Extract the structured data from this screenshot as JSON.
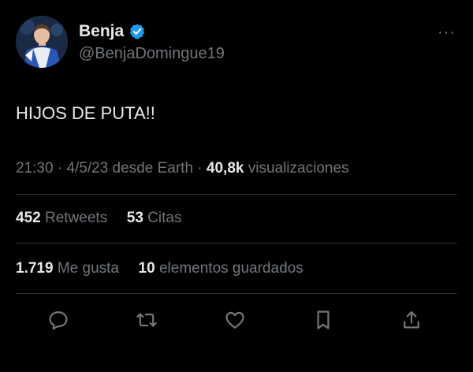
{
  "tweet": {
    "author": {
      "display_name": "Benja",
      "handle": "@BenjaDomingue19",
      "verified": true
    },
    "text": "HIJOS DE PUTA!!",
    "meta": {
      "time": "21:30",
      "date": "4/5/23",
      "source": "desde Earth",
      "views_count": "40,8k",
      "views_label": "visualizaciones"
    },
    "stats": {
      "retweets_count": "452",
      "retweets_label": "Retweets",
      "quotes_count": "53",
      "quotes_label": "Citas",
      "likes_count": "1.719",
      "likes_label": "Me gusta",
      "bookmarks_count": "10",
      "bookmarks_label": "elementos guardados"
    }
  },
  "menu": {
    "more_label": "···"
  },
  "actions": [
    "reply-icon",
    "retweet-icon",
    "like-icon",
    "bookmark-icon",
    "share-icon"
  ],
  "colors": {
    "background": "#000000",
    "primary_text": "#e7e9ea",
    "secondary_text": "#71767b",
    "divider": "#2f3336",
    "verified": "#1d9bf0"
  }
}
